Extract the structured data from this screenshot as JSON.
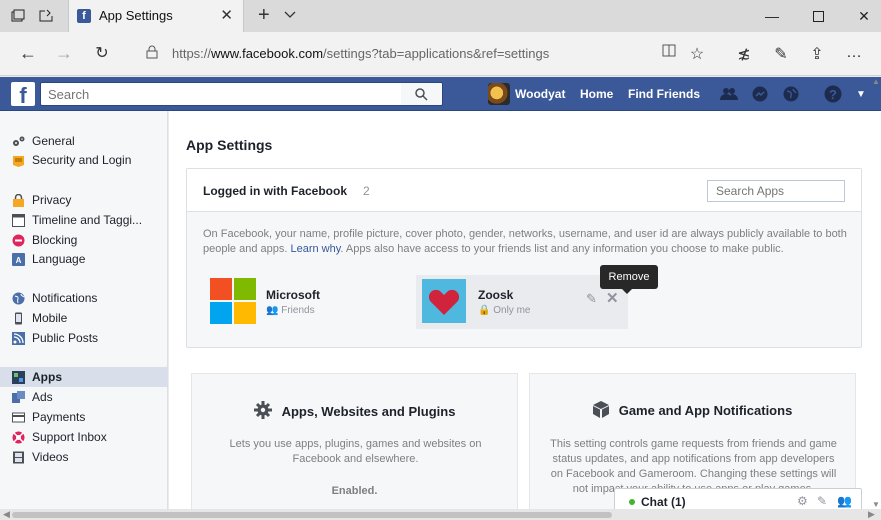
{
  "browser": {
    "tab_title": "App Settings",
    "tab_favicon": "f",
    "url_prefix": "https://",
    "url_domain": "www.facebook.com",
    "url_path": "/settings?tab=applications&ref=settings"
  },
  "fb": {
    "search_placeholder": "Search",
    "user_name": "Woodyat",
    "home_label": "Home",
    "find_friends_label": "Find Friends",
    "brand_color": "#3b5998"
  },
  "sidebar": {
    "items": [
      {
        "label": "General",
        "icon": "gear-icon"
      },
      {
        "label": "Security and Login",
        "icon": "badge-icon"
      },
      {
        "label": "Privacy",
        "icon": "lock-icon"
      },
      {
        "label": "Timeline and Taggi...",
        "icon": "timeline-icon"
      },
      {
        "label": "Blocking",
        "icon": "block-icon"
      },
      {
        "label": "Language",
        "icon": "language-icon"
      },
      {
        "label": "Notifications",
        "icon": "globe-icon"
      },
      {
        "label": "Mobile",
        "icon": "mobile-icon"
      },
      {
        "label": "Public Posts",
        "icon": "rss-icon"
      },
      {
        "label": "Apps",
        "icon": "apps-icon"
      },
      {
        "label": "Ads",
        "icon": "ads-icon"
      },
      {
        "label": "Payments",
        "icon": "card-icon"
      },
      {
        "label": "Support Inbox",
        "icon": "lifebuoy-icon"
      },
      {
        "label": "Videos",
        "icon": "film-icon"
      }
    ]
  },
  "main": {
    "title": "App Settings",
    "logged_in": {
      "heading": "Logged in with Facebook",
      "count": "2",
      "search_placeholder": "Search Apps",
      "desc_before": "On Facebook, your name, profile picture, cover photo, gender, networks, username, and user id are always publicly available to both people and apps. ",
      "desc_link": "Learn why",
      "desc_after": ". Apps also have access to your friends list and any information you choose to make public.",
      "apps": [
        {
          "name": "Microsoft",
          "audience": "Friends"
        },
        {
          "name": "Zoosk",
          "audience": "Only me"
        }
      ],
      "tooltip": "Remove"
    },
    "cards": [
      {
        "title": "Apps, Websites and Plugins",
        "desc": "Lets you use apps, plugins, games and websites on Facebook and elsewhere.",
        "status": "Enabled."
      },
      {
        "title": "Game and App Notifications",
        "desc": "This setting controls game requests from friends and game status updates, and app notifications from app developers on Facebook and Gameroom. Changing these settings will not impact your ability to use apps or play games."
      }
    ]
  },
  "chat": {
    "label": "Chat (1)"
  }
}
